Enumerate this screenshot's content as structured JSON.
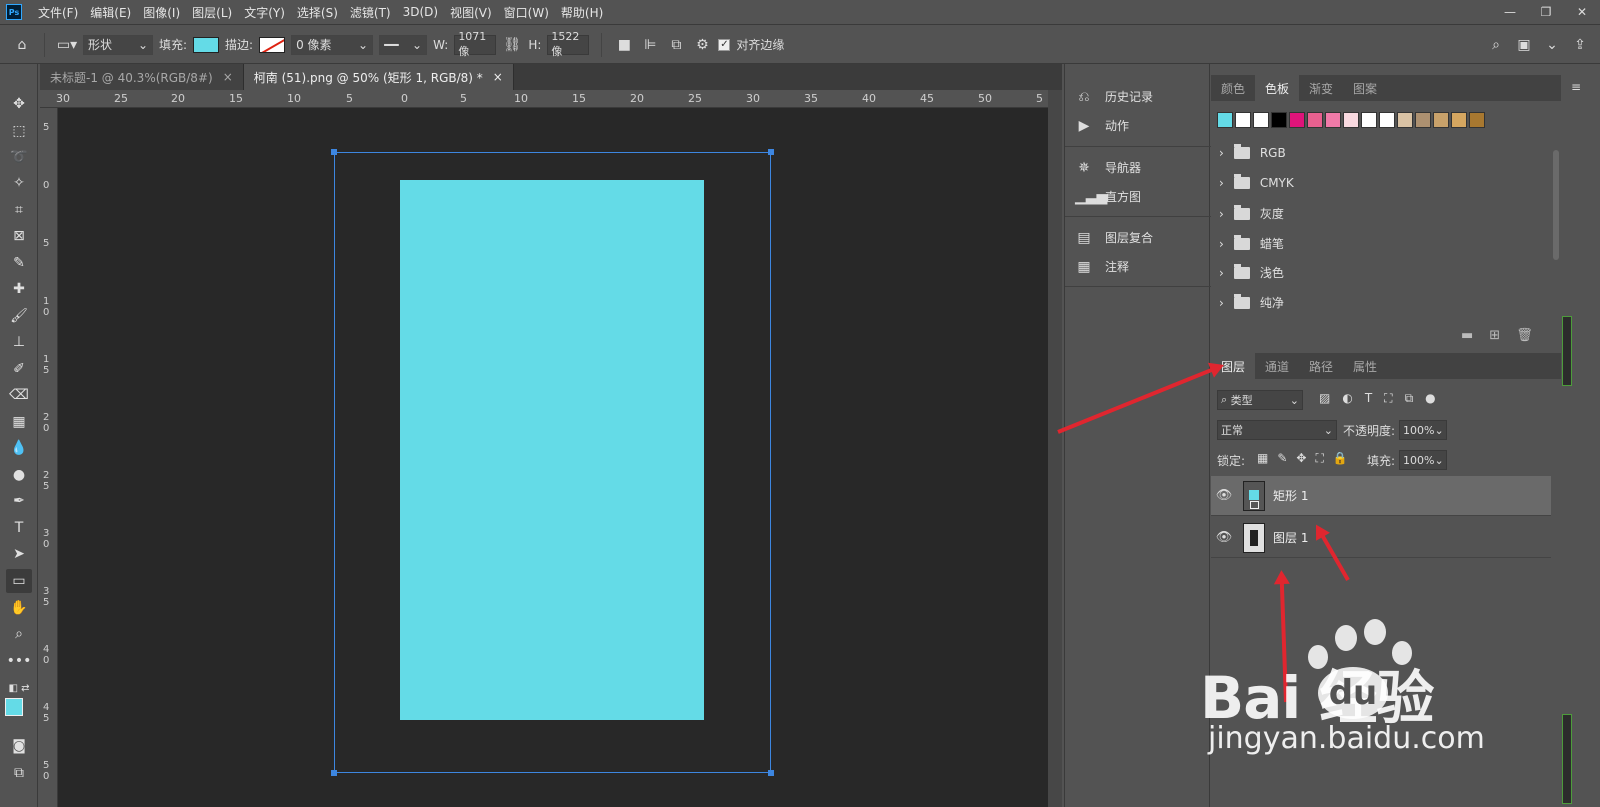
{
  "menubar": {
    "logo": "Ps",
    "items": [
      "文件(F)",
      "编辑(E)",
      "图像(I)",
      "图层(L)",
      "文字(Y)",
      "选择(S)",
      "滤镜(T)",
      "3D(D)",
      "视图(V)",
      "窗口(W)",
      "帮助(H)"
    ],
    "window_controls": [
      "—",
      "❐",
      "✕"
    ]
  },
  "options_bar": {
    "mode": "形状",
    "fill_label": "填充:",
    "fill_color": "#64dbe7",
    "stroke_label": "描边:",
    "stroke_width": "0 像素",
    "w_label": "W:",
    "w_value": "1071 像",
    "h_label": "H:",
    "h_value": "1522 像",
    "align_edges_label": "对齐边缘"
  },
  "doc_tabs": [
    {
      "label": "未标题-1 @ 40.3%(RGB/8#)",
      "close": "×"
    },
    {
      "label": "柯南 (51).png @ 50% (矩形 1, RGB/8) *",
      "close": "×"
    }
  ],
  "ruler_top": [
    "30",
    "25",
    "20",
    "15",
    "10",
    "5",
    "0",
    "5",
    "10",
    "15",
    "20",
    "25",
    "30",
    "35",
    "40",
    "45",
    "50",
    "5"
  ],
  "ruler_left": [
    "5",
    "0",
    "5",
    "1 0",
    "1 5",
    "2 0",
    "2 5",
    "3 0",
    "3 5",
    "4 0",
    "4 5",
    "5 0"
  ],
  "canvas": {
    "shape_color": "#64dbe7",
    "background": "#282828"
  },
  "mini_panels": [
    {
      "icon": "history-icon",
      "label": "历史记录"
    },
    {
      "icon": "actions-icon",
      "label": "动作"
    },
    {
      "icon": "navigator-icon",
      "label": "导航器"
    },
    {
      "icon": "histogram-icon",
      "label": "直方图"
    },
    {
      "icon": "layer-comps-icon",
      "label": "图层复合"
    },
    {
      "icon": "notes-icon",
      "label": "注释"
    }
  ],
  "swatches_panel": {
    "tabs": [
      "颜色",
      "色板",
      "渐变",
      "图案"
    ],
    "active_tab": "色板",
    "swatch_colors": [
      "#64dbe7",
      "#ffffff",
      "#ffffff",
      "#000000",
      "#e0147a",
      "#e8608f",
      "#f07aa8",
      "#f9d9e0",
      "#ffffff",
      "#ffffff",
      "#d9c2a4",
      "#ac9070",
      "#c8a16a",
      "#d6a760",
      "#a87830"
    ],
    "folders": [
      "RGB",
      "CMYK",
      "灰度",
      "蜡笔",
      "浅色",
      "纯净"
    ]
  },
  "layers_panel": {
    "tabs": [
      "图层",
      "通道",
      "路径",
      "属性"
    ],
    "active_tab": "图层",
    "filter_label": "类型",
    "blend_mode": "正常",
    "opacity_label": "不透明度:",
    "opacity_value": "100%",
    "lock_label": "锁定:",
    "fill_label": "填充:",
    "fill_value": "100%",
    "layers": [
      {
        "name": "矩形 1",
        "selected": true
      },
      {
        "name": "图层 1",
        "selected": false
      }
    ]
  },
  "watermark": {
    "big": "Bai 经验",
    "du": "du",
    "small": "jingyan.baidu.com"
  },
  "annotation_color": "#e0262f"
}
